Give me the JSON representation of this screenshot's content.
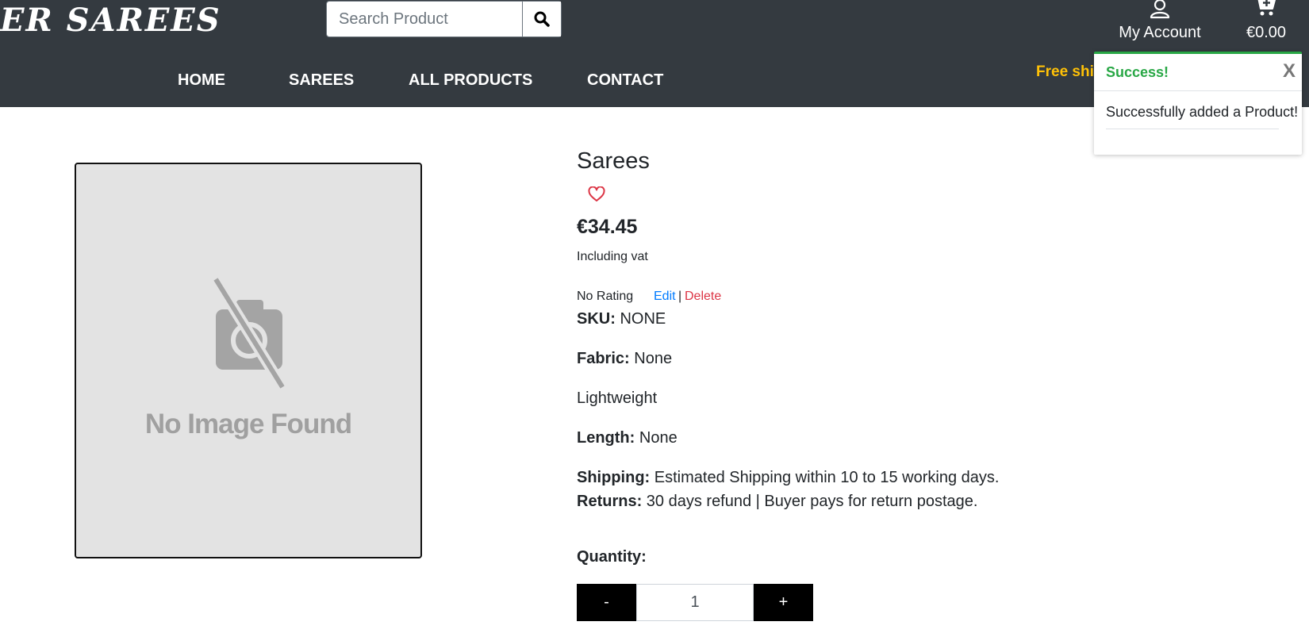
{
  "header": {
    "logo_text": "ER SAREES",
    "search": {
      "placeholder": "Search Product",
      "button_icon": "search-icon"
    },
    "account_label": "My Account",
    "cart_total": "€0.00",
    "banner_text": "Free shi",
    "colors": {
      "background": "#343a40",
      "banner": "#ffc107"
    }
  },
  "nav": {
    "items": [
      {
        "label": "HOME"
      },
      {
        "label": "SAREES"
      },
      {
        "label": "ALL PRODUCTS"
      },
      {
        "label": "CONTACT"
      }
    ]
  },
  "toast": {
    "title": "Success!",
    "close_label": "X",
    "message": "Successfully added a Product!",
    "color": "#28a745"
  },
  "product": {
    "image_placeholder_text": "No Image Found",
    "name": "Sarees",
    "price": "€34.45",
    "vat_note": "Including vat",
    "rating": "No Rating",
    "edit_label": "Edit",
    "separator": "|",
    "delete_label": "Delete",
    "sku_label": "SKU:",
    "sku_value": "NONE",
    "fabric_label": "Fabric:",
    "fabric_value": "None",
    "feature": "Lightweight",
    "length_label": "Length:",
    "length_value": "None",
    "shipping_label": "Shipping:",
    "shipping_value": "Estimated Shipping within 10 to 15 working days.",
    "returns_label": "Returns:",
    "returns_value": "30 days refund | Buyer pays for return postage.",
    "quantity_label": "Quantity:",
    "quantity_value": "1",
    "minus_label": "-",
    "plus_label": "+",
    "colors": {
      "wishlist": "#dc3545",
      "edit": "#007bff",
      "delete": "#dc3545"
    }
  }
}
